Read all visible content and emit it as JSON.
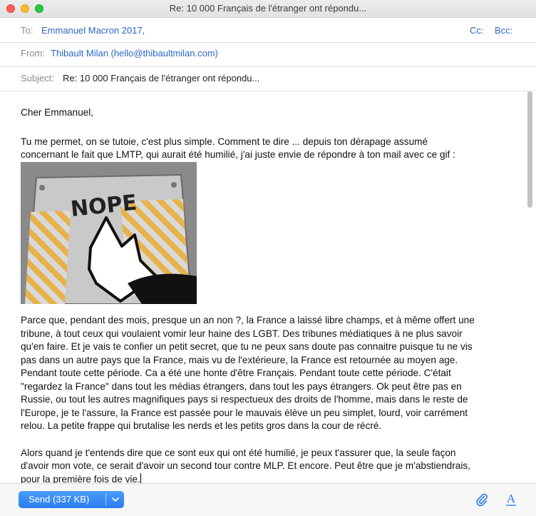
{
  "window": {
    "title": "Re: 10 000 Français de l'étranger ont répondu..."
  },
  "header": {
    "to_label": "To:",
    "to_value": "Emmanuel Macron 2017,",
    "cc_label": "Cc:",
    "bcc_label": "Bcc:",
    "from_label": "From:",
    "from_value": "Thibault Milan (hello@thibaultmilan.com)",
    "subject_label": "Subject:",
    "subject_value": "Re: 10 000 Français de l'étranger ont répondu..."
  },
  "message": {
    "greeting": "Cher Emmanuel,",
    "p1_l1": "Tu me permet, on se tutoie, c'est plus simple. Comment te dire ... depuis ton dérapage assumé",
    "p1_l2": "concernant le fait que LMTP, qui aurait été humilié, j'ai juste envie de répondre à ton mail avec ce gif :",
    "gif_text": "NOPE",
    "p2": [
      "Parce que, pendant des mois, presque un an non ?, la France a laissé libre champs, et à même offert une",
      "tribune, à tout ceux qui voulaient vomir leur haine des LGBT. Des tribunes médiatiques à ne plus savoir",
      "qu'en faire. Et je vais te confier un petit secret, que tu ne peux sans doute pas connaitre puisque tu ne vis",
      "pas dans un autre pays que la France, mais vu de l'extérieure, la France est retournée au moyen age.",
      "Pendant toute cette période. Ca a été une honte d'être Français. Pendant toute cette période. C'était",
      "\"regardez la France\" dans tout les médias étrangers, dans tout les pays étrangers. Ok peut être pas en",
      "Russie, ou tout les autres magnifiques pays si respectueux des droits de l'homme, mais dans le reste de",
      "l'Europe, je te l'assure, la France est passée pour le mauvais élève un peu simplet, lourd, voir carrément",
      "relou. La petite frappe qui brutalise les nerds et les petits gros dans la cour de récré."
    ],
    "p3": [
      "Alors quand je t'entends dire que ce sont eux qui ont été humilié, je peux t'assurer que, la seule façon",
      "d'avoir mon vote, ce serait d'avoir un second tour contre MLP. Et encore. Peut être que je m'abstiendrais,",
      "pour la première fois de vie."
    ]
  },
  "footer": {
    "send_label": "Send (337 KB)",
    "attach_icon": "paperclip-icon",
    "format_icon": "format-text-icon",
    "format_glyph": "A"
  },
  "colors": {
    "accent": "#2a7cf0",
    "link": "#2b66c6"
  }
}
